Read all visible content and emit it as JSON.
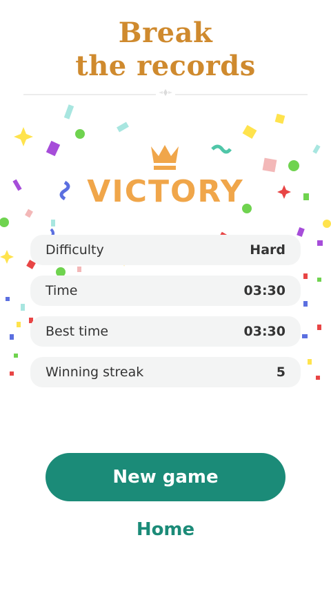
{
  "headline": {
    "line1": "Break",
    "line2": "the records"
  },
  "result": {
    "title": "VICTORY",
    "icon": "crown-icon"
  },
  "stats": [
    {
      "label": "Difficulty",
      "value": "Hard"
    },
    {
      "label": "Time",
      "value": "03:30"
    },
    {
      "label": "Best time",
      "value": "03:30"
    },
    {
      "label": "Winning streak",
      "value": "5"
    }
  ],
  "actions": {
    "new_game": "New game",
    "home": "Home"
  },
  "colors": {
    "headline": "#cf8a2e",
    "victory": "#f0a64a",
    "crown": "#f0a64a",
    "primary": "#1b8b78",
    "row_background": "#f3f4f4"
  }
}
